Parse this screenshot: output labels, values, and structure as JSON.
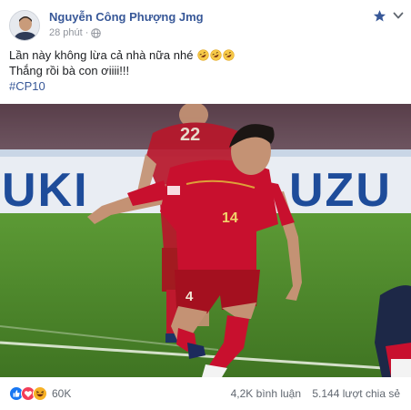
{
  "post": {
    "author": "Nguyễn Công Phượng Jmg",
    "time": "28 phút",
    "line1": "Lần này không lừa cả nhà nữa nhé",
    "line2": "Thắng rồi bà con ơiiii!!!",
    "hashtag": "#CP10",
    "line1_emojis": [
      "rofl-emoji",
      "rofl-emoji",
      "rofl-emoji"
    ]
  },
  "photo": {
    "ad_board_left": "UKI",
    "ad_board_right": "UZU",
    "background_player_number": "22",
    "player_number": "14"
  },
  "footer": {
    "reactions": [
      "like",
      "love",
      "haha"
    ],
    "reaction_count": "60K",
    "comments": "4,2K bình luận",
    "shares": "5.144 lượt chia sẻ"
  },
  "colors": {
    "link": "#385898",
    "meta": "#90949c",
    "jersey": "#c8102e",
    "pitch": "#4f8a2c"
  }
}
